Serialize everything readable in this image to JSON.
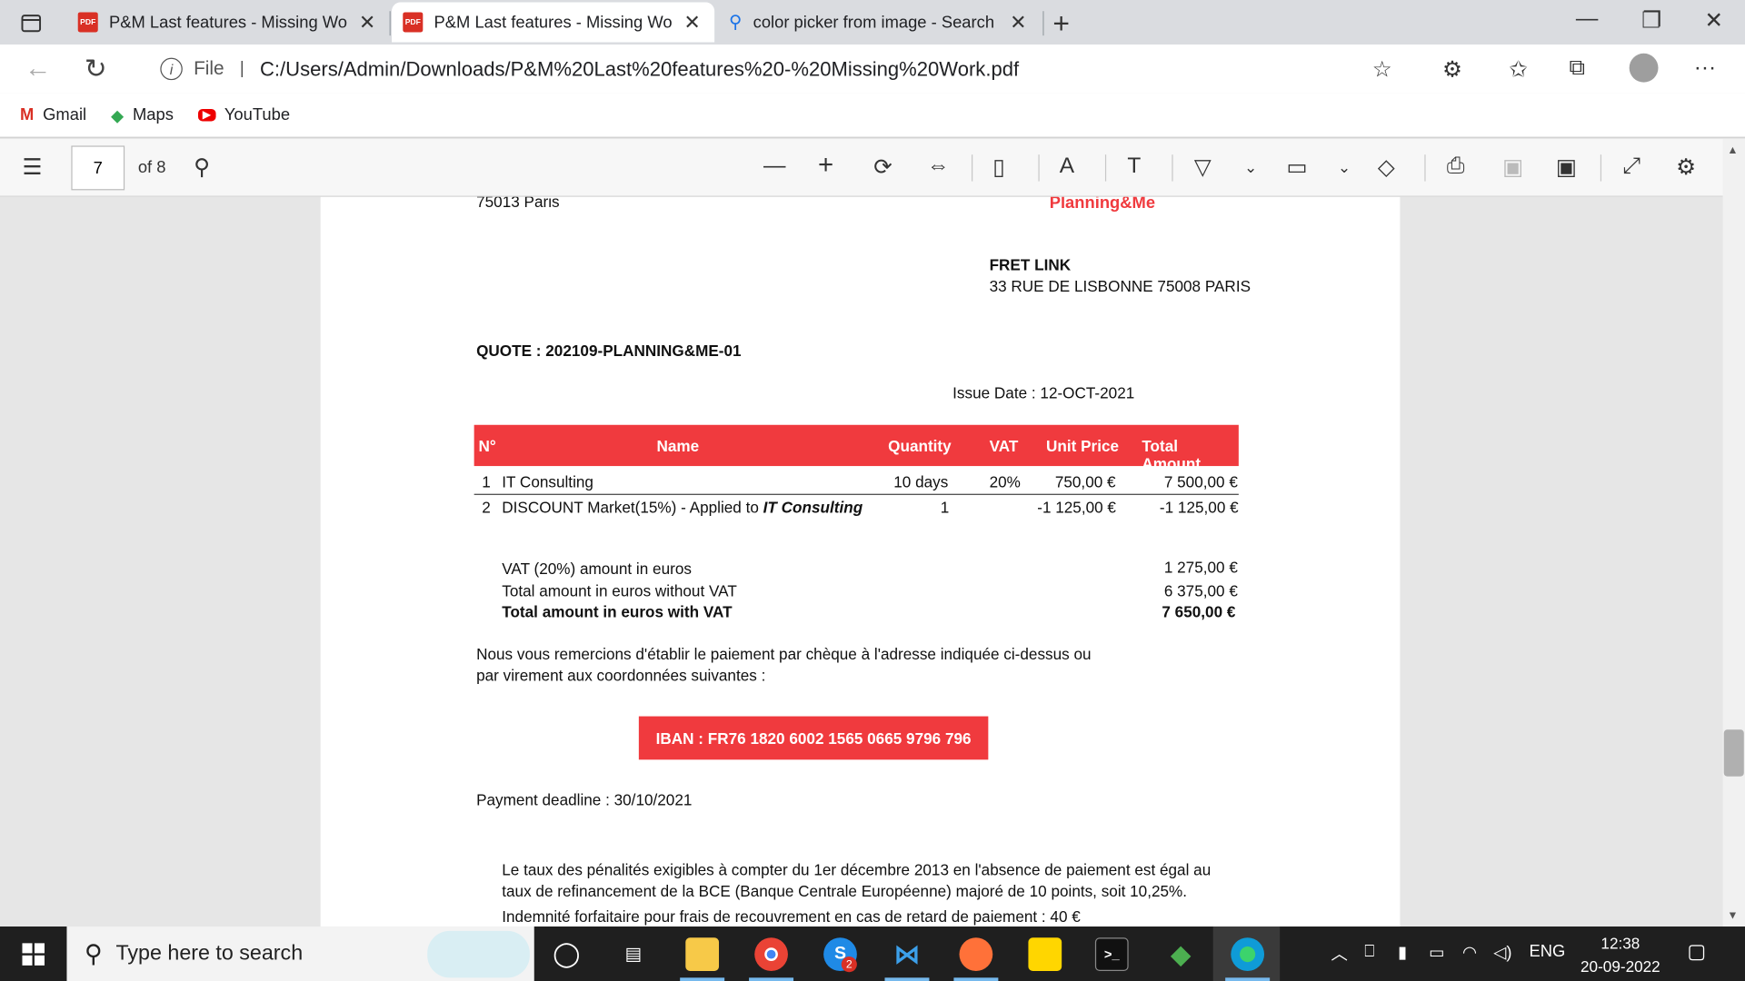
{
  "browser": {
    "tabs": [
      {
        "title": "P&M Last features - Missing Wo",
        "icon": "pdf-icon",
        "active": false
      },
      {
        "title": "P&M Last features - Missing Wo",
        "icon": "pdf-icon",
        "active": true
      },
      {
        "title": "color picker from image - Search",
        "icon": "search-icon",
        "active": false
      }
    ],
    "address": {
      "scheme_label": "File",
      "url": "C:/Users/Admin/Downloads/P&M%20Last%20features%20-%20Missing%20Work.pdf"
    },
    "bookmarks": [
      {
        "label": "Gmail",
        "icon": "gmail-icon"
      },
      {
        "label": "Maps",
        "icon": "maps-icon"
      },
      {
        "label": "YouTube",
        "icon": "youtube-icon"
      }
    ]
  },
  "pdf_toolbar": {
    "page_number": "7",
    "page_count_label": "of 8"
  },
  "document": {
    "sender_city": "75013 Paris",
    "brand": "Planning&Me",
    "recipient_name": "FRET LINK",
    "recipient_address": "33 RUE DE LISBONNE 75008 PARIS",
    "quote_label": "QUOTE : 202109-PLANNING&ME-01",
    "issue_date": "Issue Date : 12-OCT-2021",
    "table": {
      "headers": [
        "N°",
        "Name",
        "Quantity",
        "VAT",
        "Unit Price",
        "Total Amount"
      ],
      "rows": [
        {
          "n": "1",
          "name": "IT Consulting",
          "name_em": "",
          "quantity": "10 days",
          "vat": "20%",
          "unit_price": "750,00 €",
          "total": "7 500,00 €"
        },
        {
          "n": "2",
          "name": "DISCOUNT Market(15%) - Applied to ",
          "name_em": "IT Consulting",
          "quantity": "1",
          "vat": "",
          "unit_price": "-1 125,00 €",
          "total": "-1 125,00 €"
        }
      ]
    },
    "totals": [
      {
        "label": "VAT (20%) amount in euros",
        "value": "1 275,00 €",
        "bold": false
      },
      {
        "label": "Total amount in euros without VAT",
        "value": "6 375,00 €",
        "bold": false
      },
      {
        "label": "Total amount in euros with VAT",
        "value": "7 650,00 €",
        "bold": true
      }
    ],
    "payment_line1": "Nous vous remercions d'établir le paiement par chèque à l'adresse indiquée ci-dessus ou",
    "payment_line2": "par virement aux coordonnées suivantes :",
    "iban": "IBAN : FR76 1820 6002 1565 0665 9796 796",
    "deadline": "Payment deadline : 30/10/2021",
    "penalty_line1": "Le taux des pénalités exigibles à compter du 1er décembre 2013 en l'absence de paiement est égal au",
    "penalty_line2": "taux de refinancement de la BCE (Banque Centrale Européenne) majoré de 10 points, soit 10,25%.",
    "penalty_line3": "Indemnité forfaitaire pour frais de recouvrement en cas de retard de paiement : 40 €"
  },
  "taskbar": {
    "search_placeholder": "Type here to search",
    "language": "ENG",
    "time": "12:38",
    "date": "20-09-2022",
    "badge_count": "2"
  },
  "colors": {
    "accent_red": "#f03a3e",
    "taskbar": "#1f1f1f"
  }
}
